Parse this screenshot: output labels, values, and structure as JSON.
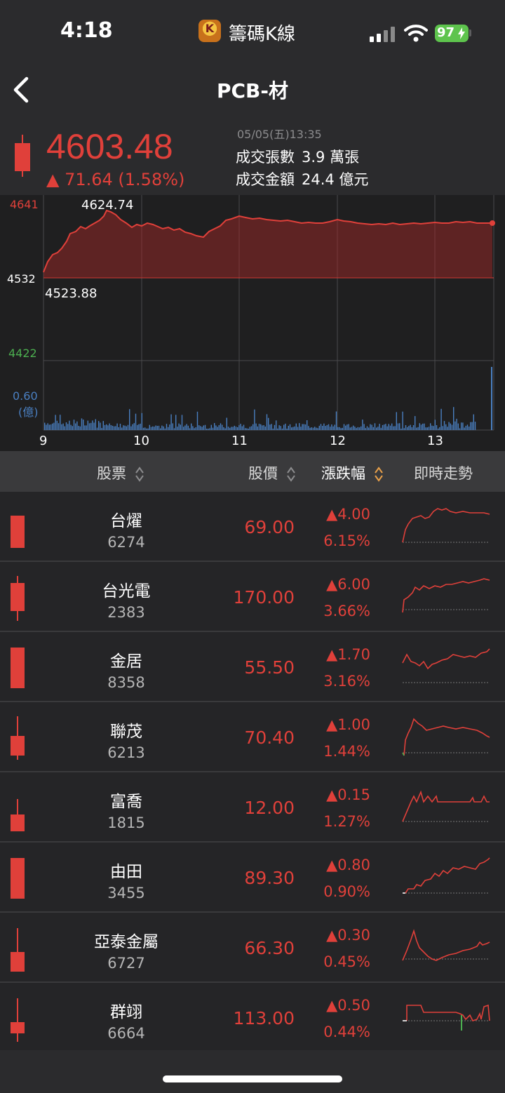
{
  "status_bar": {
    "time": "4:18",
    "app_name": "籌碼K線",
    "app_badge_letter": "K",
    "battery": "97"
  },
  "header": {
    "title": "PCB-材",
    "back_icon": "chevron-left-icon"
  },
  "summary": {
    "price": "4603.48",
    "change": "▲ 71.64 (1.58%)",
    "timestamp": "05/05(五)13:35",
    "volume_label": "成交張數",
    "volume_value": "3.9 萬張",
    "amount_label": "成交金額",
    "amount_value": "24.4 億元"
  },
  "chart": {
    "y_top": "4641",
    "y_mid": "4532",
    "y_bottom": "4422",
    "high_label": "4624.74",
    "low_label": "4523.88",
    "vol_label": "0.60",
    "vol_unit": "(億)",
    "x_ticks": [
      "9",
      "10",
      "11",
      "12",
      "13"
    ],
    "colors": {
      "up": "#e0403a",
      "down": "#4caf50",
      "volume": "#4a7fc1"
    }
  },
  "table": {
    "columns": [
      "股票",
      "股價",
      "漲跌幅",
      "即時走勢"
    ],
    "rows": [
      {
        "name": "台燿",
        "code": "6274",
        "price": "69.00",
        "change": "▲4.00",
        "pct": "6.15%"
      },
      {
        "name": "台光電",
        "code": "2383",
        "price": "170.00",
        "change": "▲6.00",
        "pct": "3.66%"
      },
      {
        "name": "金居",
        "code": "8358",
        "price": "55.50",
        "change": "▲1.70",
        "pct": "3.16%"
      },
      {
        "name": "聯茂",
        "code": "6213",
        "price": "70.40",
        "change": "▲1.00",
        "pct": "1.44%"
      },
      {
        "name": "富喬",
        "code": "1815",
        "price": "12.00",
        "change": "▲0.15",
        "pct": "1.27%"
      },
      {
        "name": "由田",
        "code": "3455",
        "price": "89.30",
        "change": "▲0.80",
        "pct": "0.90%"
      },
      {
        "name": "亞泰金屬",
        "code": "6727",
        "price": "66.30",
        "change": "▲0.30",
        "pct": "0.45%"
      },
      {
        "name": "群翊",
        "code": "6664",
        "price": "113.00",
        "change": "▲0.50",
        "pct": "0.44%"
      }
    ]
  }
}
